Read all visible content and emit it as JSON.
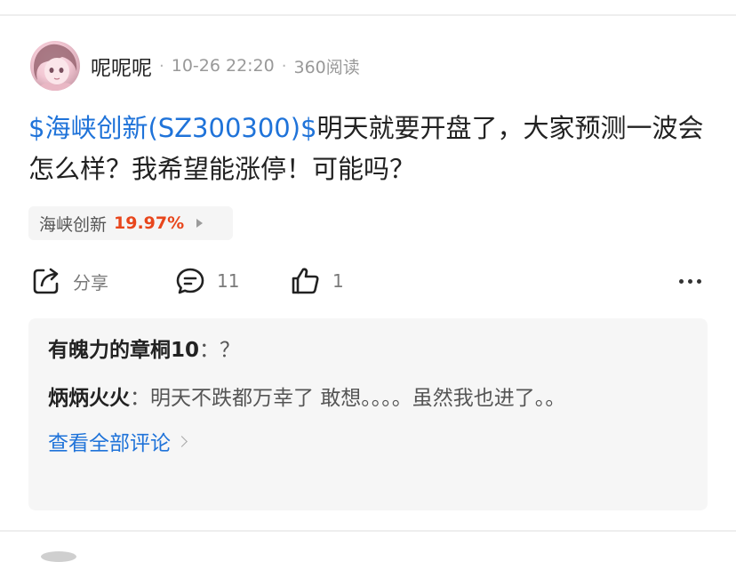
{
  "post": {
    "username": "呢呢呢",
    "time": "10-26 22:20",
    "reads": "360阅读",
    "separator": "·",
    "stock_link": "$海峡创新(SZ300300)$",
    "body_text": "明天就要开盘了，大家预测一波会怎么样？我希望能涨停！可能吗？"
  },
  "stock_tag": {
    "name": "海峡创新",
    "change": "19.97%",
    "change_color": "#e8461c"
  },
  "actions": {
    "share_label": "分享",
    "share_icon": "share-icon",
    "comment_count": "11",
    "comment_icon": "comment-bubble-icon",
    "like_count": "1",
    "like_icon": "thumbs-up-icon",
    "more_icon": "more-horizontal-icon"
  },
  "comments": [
    {
      "author": "有魄力的章桐10",
      "separator": "：",
      "text": "？"
    },
    {
      "author": "炳炳火火",
      "separator": "：",
      "text": "明天不跌都万幸了 敢想。。。。虽然我也进了。。"
    }
  ],
  "view_all_label": "查看全部评论",
  "colors": {
    "link": "#1f73d9",
    "muted": "#999999",
    "panel": "#f6f6f6"
  }
}
